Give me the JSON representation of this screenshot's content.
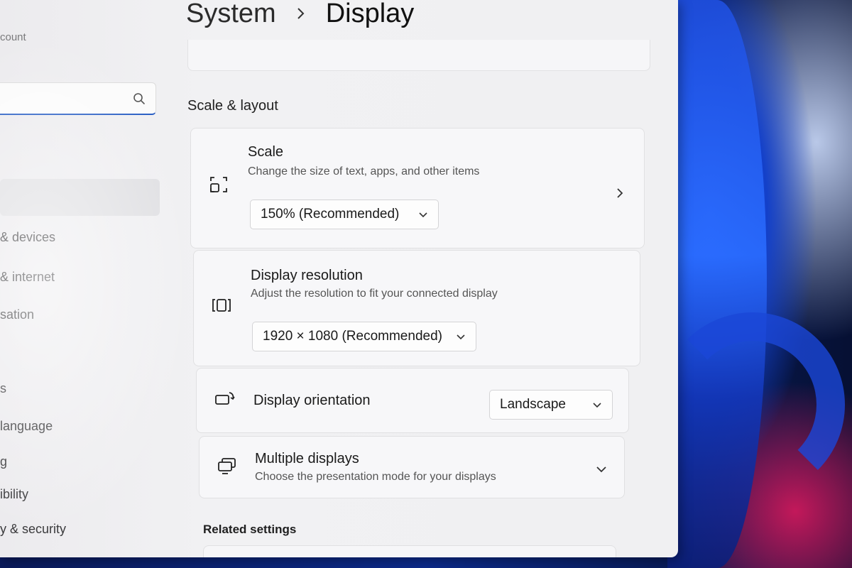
{
  "header": {
    "breadcrumb_parent": "System",
    "breadcrumb_current": "Display"
  },
  "sidebar": {
    "account_label": "count",
    "search_placeholder": "",
    "items": [
      {
        "label": "& devices"
      },
      {
        "label": "& internet"
      },
      {
        "label": "sation"
      },
      {
        "label": "s"
      },
      {
        "label": "language"
      },
      {
        "label": "g"
      },
      {
        "label": "ibility"
      },
      {
        "label": "y & security"
      }
    ]
  },
  "scale_layout": {
    "section_title": "Scale & layout",
    "scale": {
      "title": "Scale",
      "description": "Change the size of text, apps, and other items",
      "selected": "150% (Recommended)",
      "icon": "scale-icon"
    },
    "resolution": {
      "title": "Display resolution",
      "description": "Adjust the resolution to fit your connected display",
      "selected": "1920 × 1080 (Recommended)",
      "icon": "resolution-icon"
    },
    "orientation": {
      "title": "Display orientation",
      "selected": "Landscape",
      "icon": "orientation-icon"
    },
    "multiple_displays": {
      "title": "Multiple displays",
      "description": "Choose the presentation mode for your displays",
      "icon": "multiple-displays-icon"
    }
  },
  "related": {
    "title": "Related settings"
  },
  "colors": {
    "accent": "#2a5fc4",
    "window_bg": "#f0f0f2",
    "card_bg": "#f7f7f9"
  }
}
